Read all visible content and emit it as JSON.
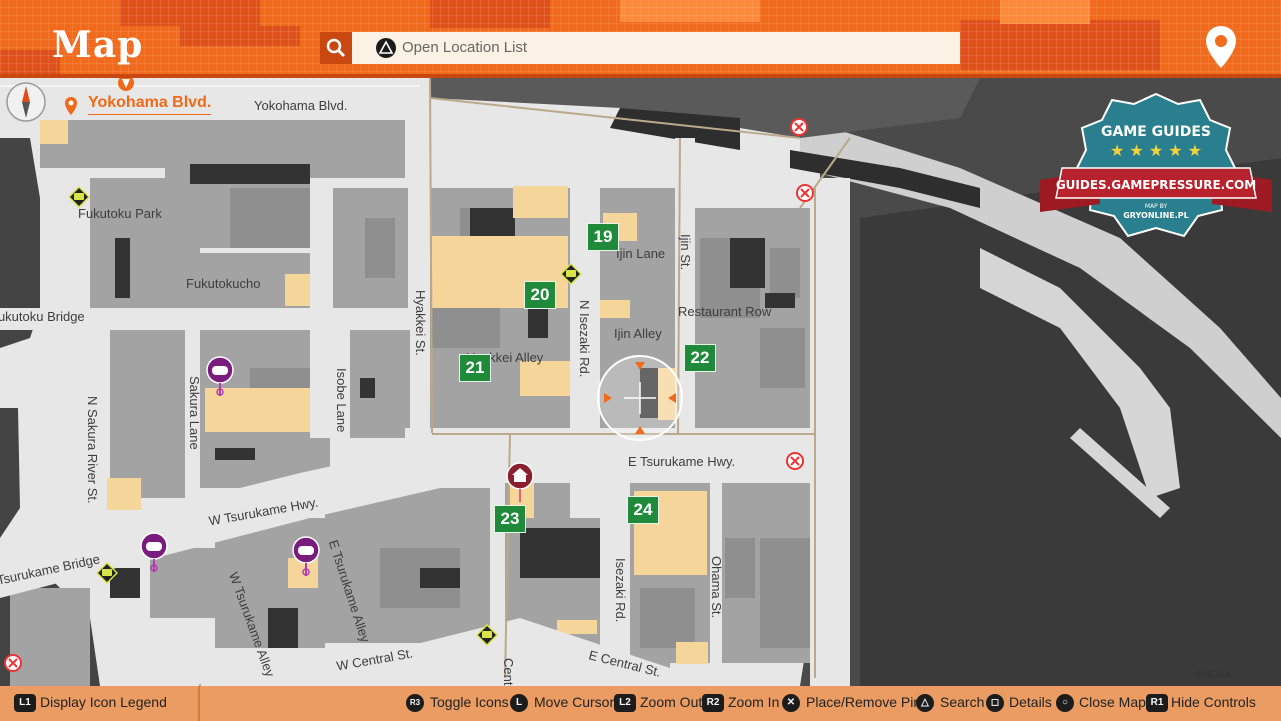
{
  "header": {
    "title": "Map",
    "search_placeholder": "Open Location List",
    "accent_color": "#f26a1b"
  },
  "location": {
    "current_area": "Yokohama Blvd."
  },
  "map_labels": {
    "streets": [
      "Yokohama Blvd.",
      "Fukutoku Park",
      "Fukutokucho",
      "Fukutoku Bridge",
      "Hyakkei St.",
      "N Sakura River St.",
      "Sakura Lane",
      "Isobe Lane",
      "Ijin Lane",
      "Ijin St.",
      "Restaurant Row",
      "Ijin Alley",
      "Hyakkei Alley",
      "N Isezaki Rd.",
      "E Tsurukame Hwy.",
      "W Tsurukame Hwy.",
      "Tsurukame Bridge",
      "E Tsurukame Alley",
      "W Tsurukame Alley",
      "W Central St.",
      "E Central St.",
      "Isezaki Rd.",
      "Ohama St.",
      "Central"
    ],
    "copyright": "©SEGA"
  },
  "markers": {
    "numbers": [
      "19",
      "20",
      "21",
      "22",
      "23",
      "24"
    ]
  },
  "icons": {
    "compass": "compass-icon",
    "search": "search-icon",
    "location_pin": "location-pin-icon",
    "chat": "chat-bubble-icon",
    "minigame": "gamepad-pin-icon",
    "home": "home-pin-icon",
    "blocked": "blocked-x-icon",
    "cursor": "map-cursor-icon"
  },
  "watermark": {
    "top": "GAME GUIDES",
    "banner": "GUIDES.GAMEPRESSURE.COM",
    "bottom_small": "MAP BY",
    "bottom": "GRYONLINE.PL"
  },
  "footer": {
    "controls": [
      {
        "key": "L1",
        "label": "Display Icon Legend"
      },
      {
        "key": "R3",
        "label": "Toggle Icons"
      },
      {
        "key": "L",
        "label": "Move Cursor"
      },
      {
        "key": "L2",
        "label": "Zoom Out"
      },
      {
        "key": "R2",
        "label": "Zoom In"
      },
      {
        "key": "✕",
        "label": "Place/Remove Pin"
      },
      {
        "key": "△",
        "label": "Search"
      },
      {
        "key": "◻",
        "label": "Details"
      },
      {
        "key": "○",
        "label": "Close Map"
      },
      {
        "key": "R1",
        "label": "Hide Controls"
      }
    ]
  }
}
